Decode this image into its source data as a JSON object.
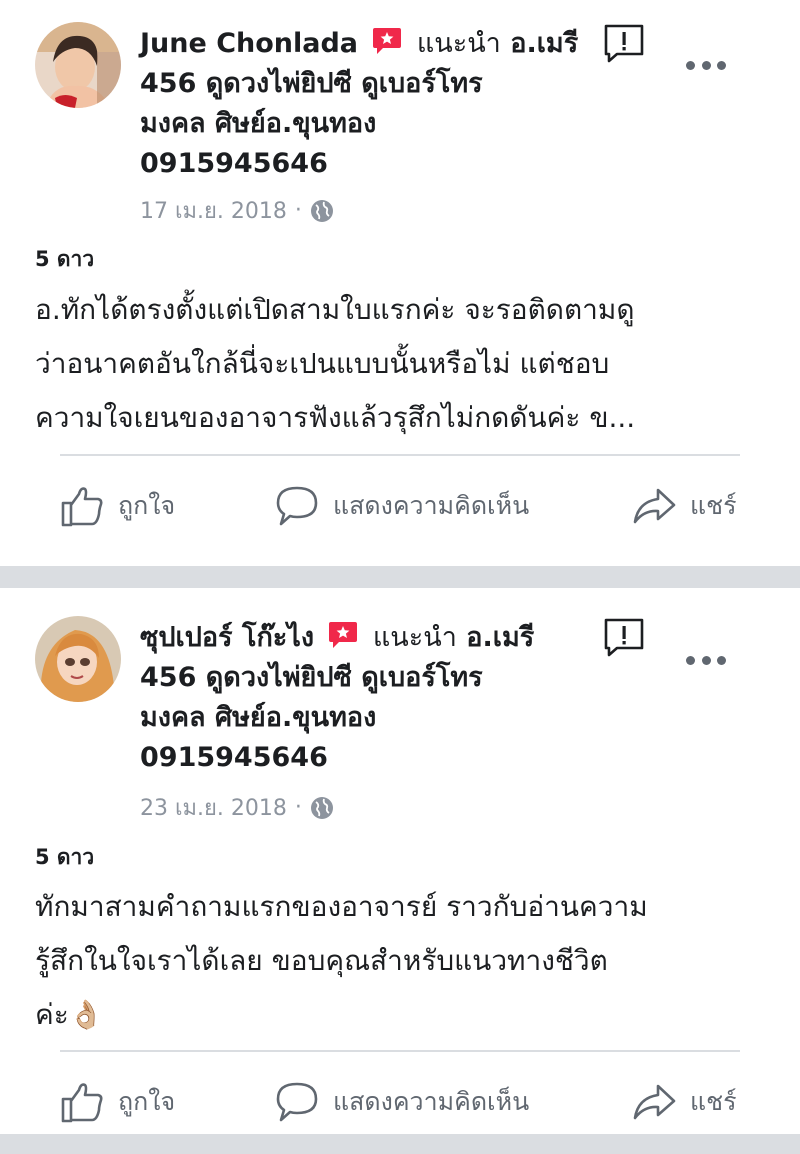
{
  "posts": [
    {
      "author": "June Chonlada",
      "recommend_label": "แนะนำ",
      "page_name_line1": "อ.เมรี",
      "page_name_line2": "456 ดูดวงไพ่ยิปซี ดูเบอร์โทร",
      "page_name_line3": "มงคล ศิษย์อ.ขุนทอง",
      "page_name_line4": "0915945646",
      "date": "17 เม.ย. 2018",
      "separator": "·",
      "rating": "5 ดาว",
      "text": "อ.ทักได้ตรงตั้งแต่เปิดสามใบแรกค่ะ จะรอติดตามดู\nว่าอนาคตอันใกล้นี่จะเปนแบบนั้นหรือไม่ แต่ชอบ\nความใจเยนของอาจารฟังแล้วรุสึกไม่กดดันค่ะ ข...",
      "like_label": "ถูกใจ",
      "comment_label": "แสดงความคิดเห็น",
      "share_label": "แชร์"
    },
    {
      "author": "ซุปเปอร์ โก๊ะไง",
      "recommend_label": "แนะนำ",
      "page_name_line1": "อ.เมรี",
      "page_name_line2": "456 ดูดวงไพ่ยิปซี ดูเบอร์โทร",
      "page_name_line3": "มงคล ศิษย์อ.ขุนทอง",
      "page_name_line4": "0915945646",
      "date": "23 เม.ย. 2018",
      "separator": "·",
      "rating": "5 ดาว",
      "text": "ทักมาสามคำถามแรกของอาจารย์ ราวกับอ่านความ\nรู้สึกในใจเราได้เลย ขอบคุณสำหรับแนวทางชีวิต\nค่ะ👌🏼",
      "like_label": "ถูกใจ",
      "comment_label": "แสดงความคิดเห็น",
      "share_label": "แชร์"
    }
  ],
  "colors": {
    "recommend_badge": "#f0284a",
    "secondary_text": "#8d949e",
    "action_text": "#606770",
    "divider": "#dadde1"
  },
  "icons": {
    "recommend": "recommend-icon",
    "report": "report-icon",
    "more": "more-icon",
    "globe": "globe-icon",
    "like": "thumbs-up-icon",
    "comment": "comment-icon",
    "share": "share-icon"
  }
}
